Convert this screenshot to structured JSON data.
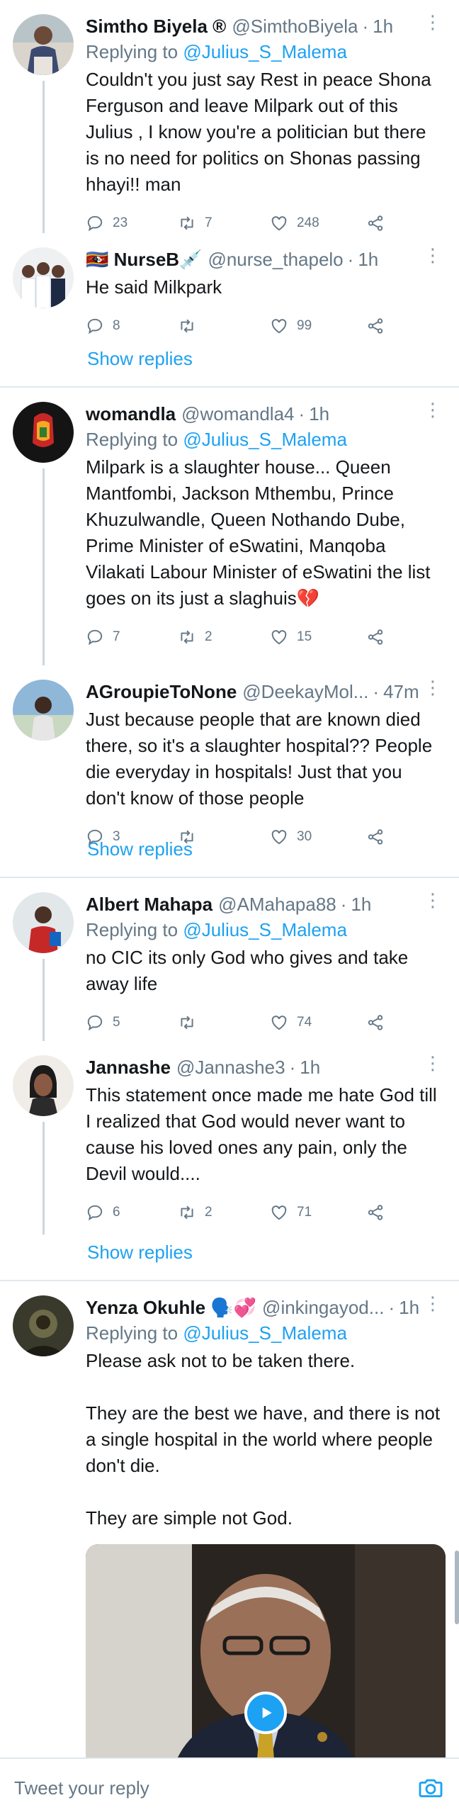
{
  "tweets": [
    {
      "name": "Simtho Biyela ®",
      "handle": "@SimthoBiyela",
      "time": "1h",
      "reply_to_prefix": "Replying to ",
      "reply_to": "@Julius_S_Malema",
      "text": "Couldn't you just say Rest in peace Shona Ferguson and leave Milpark out of this Julius , I know you're a politician but there is no need for politics on Shonas passing hhayi!! man",
      "replies": "23",
      "retweets": "7",
      "likes": "248"
    },
    {
      "name": "🇸🇿 NurseB💉",
      "handle": "@nurse_thapelo",
      "time": "1h",
      "text": "He said Milkpark",
      "replies": "8",
      "retweets": "",
      "likes": "99"
    },
    {
      "name": "womandla",
      "handle": "@womandla4",
      "time": "1h",
      "reply_to_prefix": "Replying to ",
      "reply_to": "@Julius_S_Malema",
      "text": "Milpark is a slaughter house... Queen Mantfombi, Jackson Mthembu, Prince Khuzulwandle, Queen Nothando Dube, Prime Minister of eSwatini, Manqoba Vilakati Labour Minister of eSwatini the list goes on its just a slaghuis💔",
      "replies": "7",
      "retweets": "2",
      "likes": "15"
    },
    {
      "name": "AGroupieToNone",
      "handle": "@DeekayMol...",
      "time": "47m",
      "text": "Just because people that are known died there, so it's a slaughter hospital?? People die everyday in hospitals! Just that you don't know of those people",
      "replies": "3",
      "retweets": "",
      "likes": "30"
    },
    {
      "name": "Albert Mahapa",
      "handle": "@AMahapa88",
      "time": "1h",
      "reply_to_prefix": "Replying to ",
      "reply_to": "@Julius_S_Malema",
      "text": "no CIC its only God who gives and take away life",
      "replies": "5",
      "retweets": "",
      "likes": "74"
    },
    {
      "name": "Jannashe",
      "handle": "@Jannashe3",
      "time": "1h",
      "text": "This statement once made me hate God till I realized that God would never want to cause his loved ones any pain, only the Devil would....",
      "replies": "6",
      "retweets": "2",
      "likes": "71"
    },
    {
      "name": "Yenza Okuhle 🗣️💞",
      "handle": "@inkingayod...",
      "time": "1h",
      "reply_to_prefix": "Replying to ",
      "reply_to": "@Julius_S_Malema",
      "text": "Please ask not to be taken there.\n\nThey are the best we have, and there is not a single hospital in the world where people don't die.\n\nThey are simple not God."
    }
  ],
  "show_replies_label": "Show replies",
  "separator_dot": "·",
  "more_glyph": "⋮",
  "composer": {
    "placeholder": "Tweet your reply"
  },
  "icons": [
    "reply-icon",
    "retweet-icon",
    "like-icon",
    "share-icon",
    "more-icon",
    "play-icon",
    "camera-icon"
  ],
  "colors": {
    "accent": "#1da1f2",
    "secondary_text": "#657786",
    "divider": "#e1e8ed"
  }
}
